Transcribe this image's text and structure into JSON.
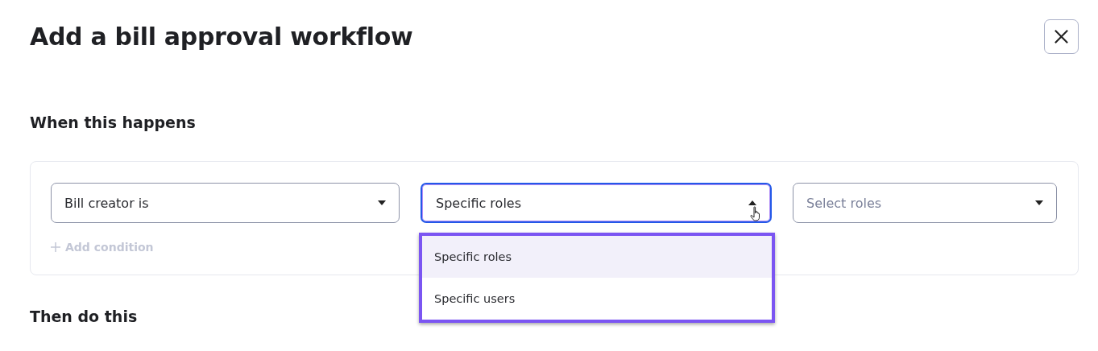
{
  "dialog": {
    "title": "Add a bill approval workflow",
    "sections": [
      {
        "heading": "When this happens",
        "conditions": [
          {
            "value": "Bill creator is",
            "expanded": false
          },
          {
            "value": "Specific roles",
            "expanded": true,
            "options": [
              {
                "label": "Specific roles",
                "selected": true
              },
              {
                "label": "Specific users",
                "selected": false
              }
            ]
          },
          {
            "placeholder": "Select roles",
            "expanded": false
          }
        ],
        "add_condition": {
          "label": "Add condition",
          "disabled": true
        }
      },
      {
        "heading": "Then do this"
      }
    ]
  }
}
